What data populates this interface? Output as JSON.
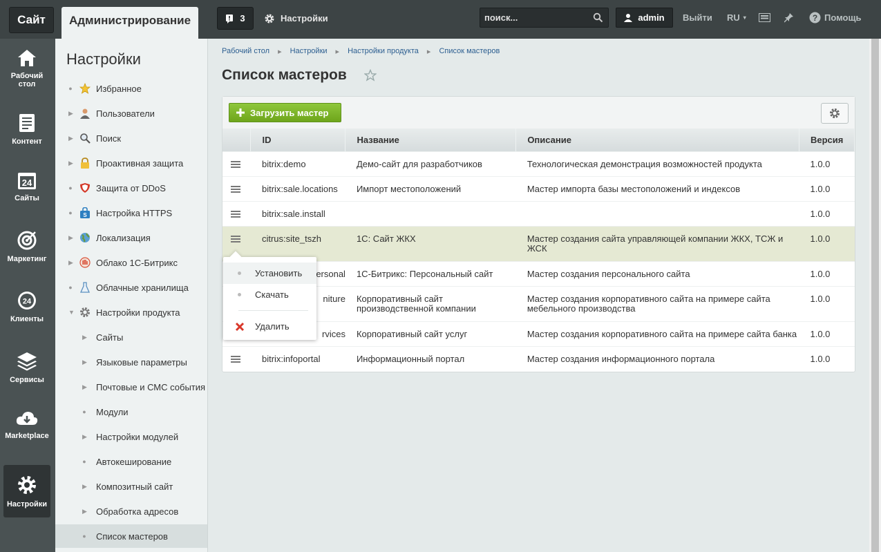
{
  "topbar": {
    "site_tab": "Сайт",
    "admin_tab": "Администрирование",
    "notifications_count": "3",
    "settings_label": "Настройки",
    "search_placeholder": "поиск...",
    "user_name": "admin",
    "logout_label": "Выйти",
    "lang_label": "RU",
    "help_label": "Помощь"
  },
  "leftnav": [
    {
      "label1": "Рабочий",
      "label2": "стол",
      "icon": "home-icon"
    },
    {
      "label1": "Контент",
      "label2": "",
      "icon": "document-icon"
    },
    {
      "label1": "Сайты",
      "label2": "",
      "icon": "calendar-24-icon"
    },
    {
      "label1": "Маркетинг",
      "label2": "",
      "icon": "target-icon"
    },
    {
      "label1": "Клиенты",
      "label2": "",
      "icon": "clients-24-icon"
    },
    {
      "label1": "Сервисы",
      "label2": "",
      "icon": "layers-icon"
    },
    {
      "label1": "Marketplace",
      "label2": "",
      "icon": "cloud-download-icon"
    },
    {
      "label1": "Настройки",
      "label2": "",
      "icon": "gear-icon"
    }
  ],
  "sidemenu": {
    "title": "Настройки",
    "items": [
      {
        "label": "Избранное"
      },
      {
        "label": "Пользователи"
      },
      {
        "label": "Поиск"
      },
      {
        "label": "Проактивная защита"
      },
      {
        "label": "Защита от DDoS"
      },
      {
        "label": "Настройка HTTPS"
      },
      {
        "label": "Локализация"
      },
      {
        "label": "Облако 1С-Битрикс"
      },
      {
        "label": "Облачные хранилища"
      },
      {
        "label": "Настройки продукта"
      },
      {
        "label": "Сайты"
      },
      {
        "label": "Языковые параметры"
      },
      {
        "label": "Почтовые и СМС события"
      },
      {
        "label": "Модули"
      },
      {
        "label": "Настройки модулей"
      },
      {
        "label": "Автокеширование"
      },
      {
        "label": "Композитный сайт"
      },
      {
        "label": "Обработка адресов"
      },
      {
        "label": "Список мастеров"
      }
    ]
  },
  "breadcrumbs": [
    "Рабочий стол",
    "Настройки",
    "Настройки продукта",
    "Список мастеров"
  ],
  "page_title": "Список мастеров",
  "toolbar": {
    "load_label": "Загрузить мастер"
  },
  "table": {
    "headers": [
      "ID",
      "Название",
      "Описание",
      "Версия"
    ],
    "rows": [
      {
        "id": "bitrix:demo",
        "name": "Демо-сайт для разработчиков",
        "desc": "Технологическая демонстрация возможностей продукта",
        "ver": "1.0.0"
      },
      {
        "id": "bitrix:sale.locations",
        "name": "Импорт местоположений",
        "desc": "Мастер импорта базы местоположений и индексов",
        "ver": "1.0.0"
      },
      {
        "id": "bitrix:sale.install",
        "name": "",
        "desc": "",
        "ver": "1.0.0"
      },
      {
        "id": "citrus:site_tszh",
        "name": "1С: Сайт ЖКХ",
        "desc": "Мастер создания сайта управляющей компании ЖКХ, ТСЖ и ЖСК",
        "ver": "1.0.0"
      },
      {
        "id": "ersonal",
        "name": "1С-Битрикс: Персональный сайт",
        "desc": "Мастер создания персонального сайта",
        "ver": "1.0.0"
      },
      {
        "id": "niture",
        "name": "Корпоративный сайт производственной компании",
        "desc": "Мастер создания корпоративного сайта на примере сайта мебельного производства",
        "ver": "1.0.0"
      },
      {
        "id": "rvices",
        "name": "Корпоративный сайт услуг",
        "desc": "Мастер создания корпоративного сайта на примере сайта банка",
        "ver": "1.0.0"
      },
      {
        "id": "bitrix:infoportal",
        "name": "Информационный портал",
        "desc": "Мастер создания информационного портала",
        "ver": "1.0.0"
      }
    ]
  },
  "context_menu": {
    "install": "Установить",
    "download": "Скачать",
    "delete": "Удалить"
  }
}
